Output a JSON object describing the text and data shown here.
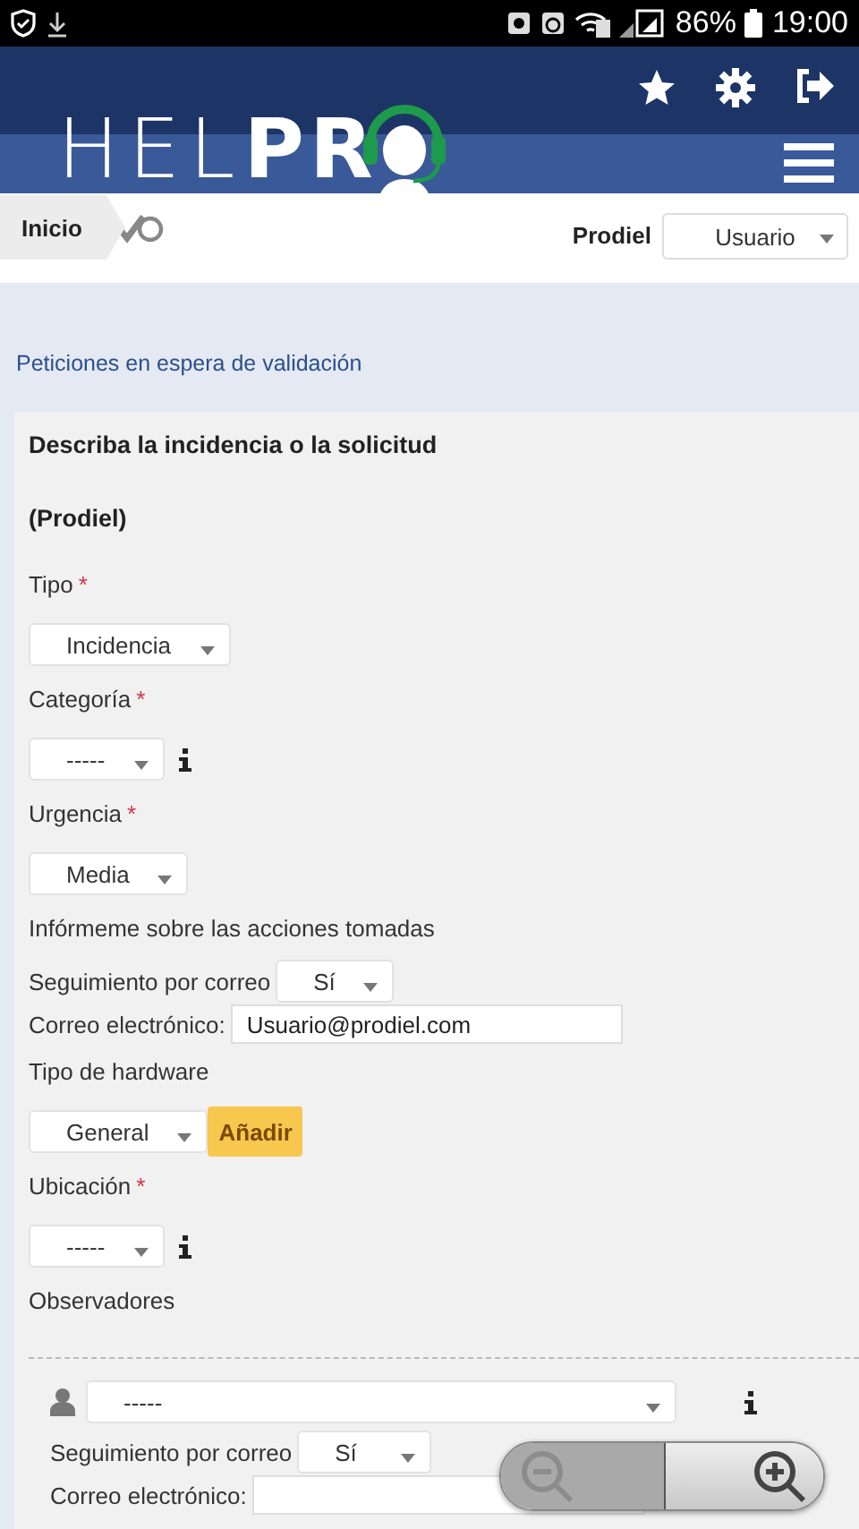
{
  "status_bar": {
    "battery": "86%",
    "time": "19:00"
  },
  "header": {
    "logo": "HEL**PR**"
  },
  "breadcrumb": {
    "home": "Inicio",
    "company": "Prodiel",
    "role": "Usuario"
  },
  "page_link": "Peticiones en espera de validación",
  "form": {
    "title": "Describa la incidencia o la solicitud",
    "subtitle": "(Prodiel)",
    "items": [
      {
        "kind": "label",
        "text": "Tipo",
        "mark": "*"
      },
      {
        "kind": "select",
        "value": "Incidencia",
        "info": false
      },
      {
        "kind": "label",
        "text": "Categoría",
        "mark": "*"
      },
      {
        "kind": "select",
        "value": "-----",
        "info": true
      },
      {
        "kind": "label",
        "text": "Urgencia",
        "mark": "*"
      },
      {
        "kind": "select",
        "value": "Media",
        "info": false
      },
      {
        "kind": "label",
        "text": "Infórmeme sobre las acciones tomadas"
      },
      {
        "kind": "select_row",
        "label": "Seguimiento por correo",
        "value": "Sí"
      },
      {
        "kind": "input_row",
        "label": "Correo electrónico:",
        "value": "Usuario@prodiel.com"
      },
      {
        "kind": "label",
        "text": "Tipo de hardware"
      },
      {
        "kind": "select_button",
        "value": "General",
        "button": "Añadir"
      },
      {
        "kind": "label",
        "text": "Ubicación",
        "mark": "*"
      },
      {
        "kind": "select",
        "value": "-----",
        "info": true
      },
      {
        "kind": "label",
        "text": "Observadores"
      },
      {
        "kind": "divider"
      }
    ]
  },
  "observer": {
    "select": "-----",
    "follow_label": "Seguimiento por correo",
    "follow_value": "Sí",
    "email_label": "Correo electrónico:"
  }
}
